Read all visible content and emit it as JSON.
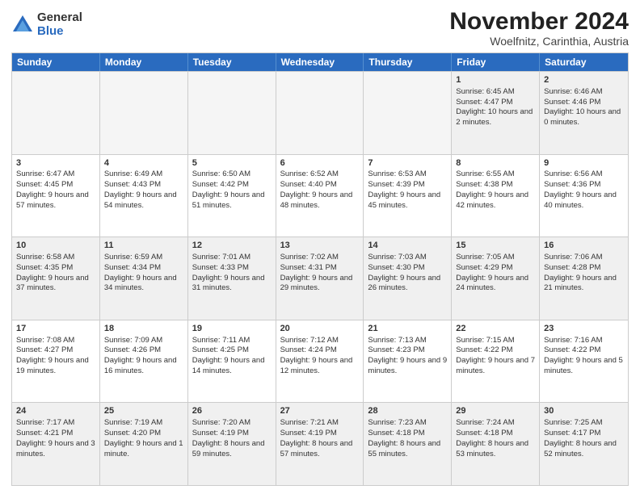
{
  "logo": {
    "general": "General",
    "blue": "Blue"
  },
  "title": "November 2024",
  "subtitle": "Woelfnitz, Carinthia, Austria",
  "calendar": {
    "headers": [
      "Sunday",
      "Monday",
      "Tuesday",
      "Wednesday",
      "Thursday",
      "Friday",
      "Saturday"
    ],
    "rows": [
      [
        {
          "day": "",
          "info": "",
          "empty": true
        },
        {
          "day": "",
          "info": "",
          "empty": true
        },
        {
          "day": "",
          "info": "",
          "empty": true
        },
        {
          "day": "",
          "info": "",
          "empty": true
        },
        {
          "day": "",
          "info": "",
          "empty": true
        },
        {
          "day": "1",
          "info": "Sunrise: 6:45 AM\nSunset: 4:47 PM\nDaylight: 10 hours and 2 minutes.",
          "empty": false
        },
        {
          "day": "2",
          "info": "Sunrise: 6:46 AM\nSunset: 4:46 PM\nDaylight: 10 hours and 0 minutes.",
          "empty": false
        }
      ],
      [
        {
          "day": "3",
          "info": "Sunrise: 6:47 AM\nSunset: 4:45 PM\nDaylight: 9 hours and 57 minutes.",
          "empty": false
        },
        {
          "day": "4",
          "info": "Sunrise: 6:49 AM\nSunset: 4:43 PM\nDaylight: 9 hours and 54 minutes.",
          "empty": false
        },
        {
          "day": "5",
          "info": "Sunrise: 6:50 AM\nSunset: 4:42 PM\nDaylight: 9 hours and 51 minutes.",
          "empty": false
        },
        {
          "day": "6",
          "info": "Sunrise: 6:52 AM\nSunset: 4:40 PM\nDaylight: 9 hours and 48 minutes.",
          "empty": false
        },
        {
          "day": "7",
          "info": "Sunrise: 6:53 AM\nSunset: 4:39 PM\nDaylight: 9 hours and 45 minutes.",
          "empty": false
        },
        {
          "day": "8",
          "info": "Sunrise: 6:55 AM\nSunset: 4:38 PM\nDaylight: 9 hours and 42 minutes.",
          "empty": false
        },
        {
          "day": "9",
          "info": "Sunrise: 6:56 AM\nSunset: 4:36 PM\nDaylight: 9 hours and 40 minutes.",
          "empty": false
        }
      ],
      [
        {
          "day": "10",
          "info": "Sunrise: 6:58 AM\nSunset: 4:35 PM\nDaylight: 9 hours and 37 minutes.",
          "empty": false
        },
        {
          "day": "11",
          "info": "Sunrise: 6:59 AM\nSunset: 4:34 PM\nDaylight: 9 hours and 34 minutes.",
          "empty": false
        },
        {
          "day": "12",
          "info": "Sunrise: 7:01 AM\nSunset: 4:33 PM\nDaylight: 9 hours and 31 minutes.",
          "empty": false
        },
        {
          "day": "13",
          "info": "Sunrise: 7:02 AM\nSunset: 4:31 PM\nDaylight: 9 hours and 29 minutes.",
          "empty": false
        },
        {
          "day": "14",
          "info": "Sunrise: 7:03 AM\nSunset: 4:30 PM\nDaylight: 9 hours and 26 minutes.",
          "empty": false
        },
        {
          "day": "15",
          "info": "Sunrise: 7:05 AM\nSunset: 4:29 PM\nDaylight: 9 hours and 24 minutes.",
          "empty": false
        },
        {
          "day": "16",
          "info": "Sunrise: 7:06 AM\nSunset: 4:28 PM\nDaylight: 9 hours and 21 minutes.",
          "empty": false
        }
      ],
      [
        {
          "day": "17",
          "info": "Sunrise: 7:08 AM\nSunset: 4:27 PM\nDaylight: 9 hours and 19 minutes.",
          "empty": false
        },
        {
          "day": "18",
          "info": "Sunrise: 7:09 AM\nSunset: 4:26 PM\nDaylight: 9 hours and 16 minutes.",
          "empty": false
        },
        {
          "day": "19",
          "info": "Sunrise: 7:11 AM\nSunset: 4:25 PM\nDaylight: 9 hours and 14 minutes.",
          "empty": false
        },
        {
          "day": "20",
          "info": "Sunrise: 7:12 AM\nSunset: 4:24 PM\nDaylight: 9 hours and 12 minutes.",
          "empty": false
        },
        {
          "day": "21",
          "info": "Sunrise: 7:13 AM\nSunset: 4:23 PM\nDaylight: 9 hours and 9 minutes.",
          "empty": false
        },
        {
          "day": "22",
          "info": "Sunrise: 7:15 AM\nSunset: 4:22 PM\nDaylight: 9 hours and 7 minutes.",
          "empty": false
        },
        {
          "day": "23",
          "info": "Sunrise: 7:16 AM\nSunset: 4:22 PM\nDaylight: 9 hours and 5 minutes.",
          "empty": false
        }
      ],
      [
        {
          "day": "24",
          "info": "Sunrise: 7:17 AM\nSunset: 4:21 PM\nDaylight: 9 hours and 3 minutes.",
          "empty": false
        },
        {
          "day": "25",
          "info": "Sunrise: 7:19 AM\nSunset: 4:20 PM\nDaylight: 9 hours and 1 minute.",
          "empty": false
        },
        {
          "day": "26",
          "info": "Sunrise: 7:20 AM\nSunset: 4:19 PM\nDaylight: 8 hours and 59 minutes.",
          "empty": false
        },
        {
          "day": "27",
          "info": "Sunrise: 7:21 AM\nSunset: 4:19 PM\nDaylight: 8 hours and 57 minutes.",
          "empty": false
        },
        {
          "day": "28",
          "info": "Sunrise: 7:23 AM\nSunset: 4:18 PM\nDaylight: 8 hours and 55 minutes.",
          "empty": false
        },
        {
          "day": "29",
          "info": "Sunrise: 7:24 AM\nSunset: 4:18 PM\nDaylight: 8 hours and 53 minutes.",
          "empty": false
        },
        {
          "day": "30",
          "info": "Sunrise: 7:25 AM\nSunset: 4:17 PM\nDaylight: 8 hours and 52 minutes.",
          "empty": false
        }
      ]
    ]
  }
}
